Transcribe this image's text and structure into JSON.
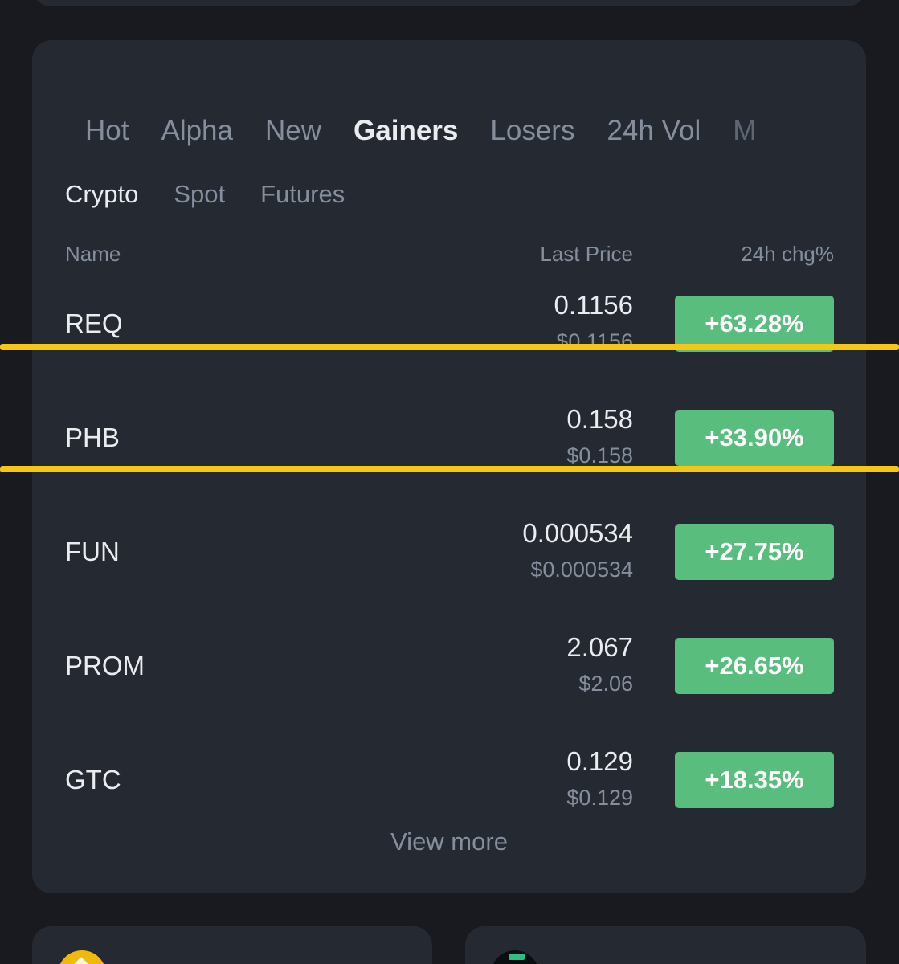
{
  "main_tabs": [
    "Hot",
    "Alpha",
    "New",
    "Gainers",
    "Losers",
    "24h Vol",
    "M"
  ],
  "main_tab_active": "Gainers",
  "sub_tabs": [
    "Crypto",
    "Spot",
    "Futures"
  ],
  "sub_tab_active": "Crypto",
  "columns": {
    "name": "Name",
    "last_price": "Last Price",
    "change": "24h chg%"
  },
  "rows": [
    {
      "symbol": "REQ",
      "price": "0.1156",
      "usd": "$0.1156",
      "change": "+63.28%"
    },
    {
      "symbol": "PHB",
      "price": "0.158",
      "usd": "$0.158",
      "change": "+33.90%"
    },
    {
      "symbol": "FUN",
      "price": "0.000534",
      "usd": "$0.000534",
      "change": "+27.75%"
    },
    {
      "symbol": "PROM",
      "price": "2.067",
      "usd": "$2.06",
      "change": "+26.65%"
    },
    {
      "symbol": "GTC",
      "price": "0.129",
      "usd": "$0.129",
      "change": "+18.35%"
    }
  ],
  "view_more": "View more",
  "colors": {
    "background": "#181a20",
    "card": "#252932",
    "gain": "#58bd7d",
    "highlight": "#f5c614",
    "muted_text": "#848e9c"
  }
}
